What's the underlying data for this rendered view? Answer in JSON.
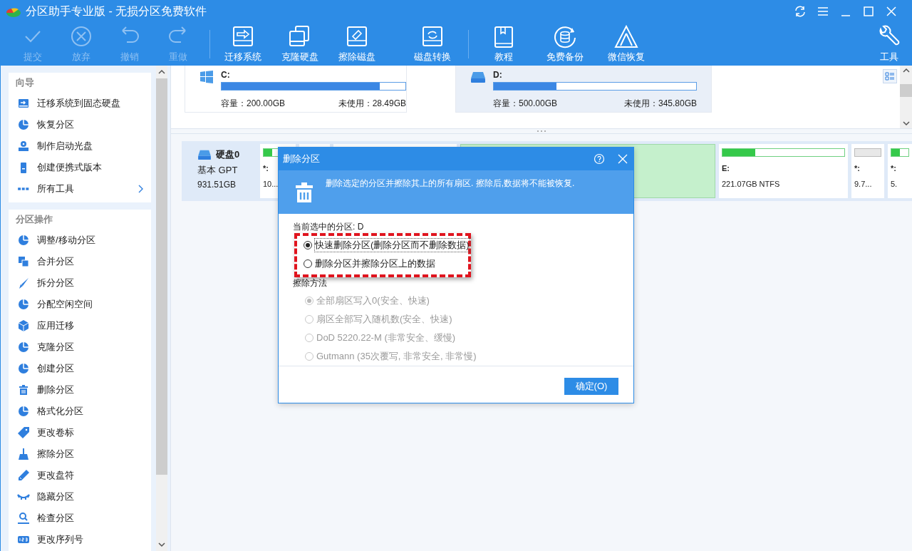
{
  "window": {
    "title": "分区助手专业版 - 无损分区免费软件"
  },
  "toolbar": {
    "groups": [
      [
        {
          "label": "提交",
          "kind": "check",
          "disabled": true
        },
        {
          "label": "放弃",
          "kind": "cancel",
          "disabled": true
        },
        {
          "label": "撤销",
          "kind": "undo",
          "disabled": true
        },
        {
          "label": "重做",
          "kind": "redo",
          "disabled": true
        }
      ],
      [
        {
          "label": "迁移系统",
          "kind": "migrate",
          "disabled": false
        },
        {
          "label": "克隆硬盘",
          "kind": "clone",
          "disabled": false
        },
        {
          "label": "擦除磁盘",
          "kind": "wipe",
          "disabled": false
        },
        {
          "label": "磁盘转换",
          "kind": "convert",
          "disabled": false
        }
      ],
      [
        {
          "label": "教程",
          "kind": "book",
          "disabled": false
        },
        {
          "label": "免费备份",
          "kind": "backup",
          "disabled": false
        },
        {
          "label": "微信恢复",
          "kind": "recover",
          "disabled": false
        }
      ]
    ],
    "end_item": {
      "label": "工具",
      "kind": "wrench",
      "disabled": false
    }
  },
  "sidebar": {
    "sections": [
      {
        "title": "向导",
        "items": [
          {
            "label": "迁移系统到固态硬盘",
            "kind": "drive"
          },
          {
            "label": "恢复分区",
            "kind": "pie"
          },
          {
            "label": "制作启动光盘",
            "kind": "disc"
          },
          {
            "label": "创建便携式版本",
            "kind": "usb"
          },
          {
            "label": "所有工具",
            "kind": "dots",
            "expandable": true
          }
        ]
      },
      {
        "title": "分区操作",
        "items": [
          {
            "label": "调整/移动分区",
            "kind": "pie"
          },
          {
            "label": "合并分区",
            "kind": "squares"
          },
          {
            "label": "拆分分区",
            "kind": "knife"
          },
          {
            "label": "分配空闲空间",
            "kind": "pie"
          },
          {
            "label": "应用迁移",
            "kind": "cube"
          },
          {
            "label": "克隆分区",
            "kind": "pie"
          },
          {
            "label": "创建分区",
            "kind": "pie"
          },
          {
            "label": "删除分区",
            "kind": "trash"
          },
          {
            "label": "格式化分区",
            "kind": "pie"
          },
          {
            "label": "更改卷标",
            "kind": "tag"
          },
          {
            "label": "擦除分区",
            "kind": "broom"
          },
          {
            "label": "更改盘符",
            "kind": "pencil"
          },
          {
            "label": "隐藏分区",
            "kind": "eye"
          },
          {
            "label": "检查分区",
            "kind": "search"
          },
          {
            "label": "更改序列号",
            "kind": "numbers"
          }
        ]
      }
    ]
  },
  "volumes": [
    {
      "name": "C:",
      "kind": "windows",
      "level": 0.86,
      "capacity": "容量：200.00GB",
      "free": "未使用：28.49GB",
      "selected": false
    },
    {
      "name": "D:",
      "kind": "drive",
      "level": 0.31,
      "capacity": "容量：500.00GB",
      "free": "未使用：345.80GB",
      "selected": true
    }
  ],
  "disk": {
    "name": "硬盘0",
    "type": "基本 GPT",
    "size": "931.51GB",
    "partitions": [
      {
        "label": "*:",
        "size": "10...",
        "level": 0.3,
        "selected": false
      },
      {
        "selected": false
      },
      {
        "selected": false
      },
      {
        "selected": true
      },
      {
        "label": "E:",
        "size": "221.07GB NTFS",
        "level": 0.27,
        "selected": false
      },
      {
        "label": "*:",
        "size": "9.7...",
        "selected": false
      },
      {
        "label": "*:",
        "size": "5.",
        "level": 0.5,
        "selected": false
      }
    ]
  },
  "dialog": {
    "title": "删除分区",
    "message": "删除选定的分区并擦除其上的所有扇区. 擦除后,数据将不能被恢复.",
    "current": "当前选中的分区: D",
    "options": [
      {
        "label": "快速删除分区(删除分区而不删除数据)",
        "selected": true,
        "disabled": false
      },
      {
        "label": "删除分区并擦除分区上的数据",
        "selected": false,
        "disabled": false
      }
    ],
    "method_title": "擦除方法",
    "methods": [
      {
        "label": "全部扇区写入0(安全、快速)",
        "selected": true,
        "disabled": true
      },
      {
        "label": "扇区全部写入随机数(安全、快速)",
        "selected": false,
        "disabled": true
      },
      {
        "label": "DoD 5220.22-M (非常安全、缓慢)",
        "selected": false,
        "disabled": true
      },
      {
        "label": "Gutmann (35次覆写, 非常安全, 非常慢)",
        "selected": false,
        "disabled": true
      }
    ],
    "ok": "确定(O)"
  }
}
